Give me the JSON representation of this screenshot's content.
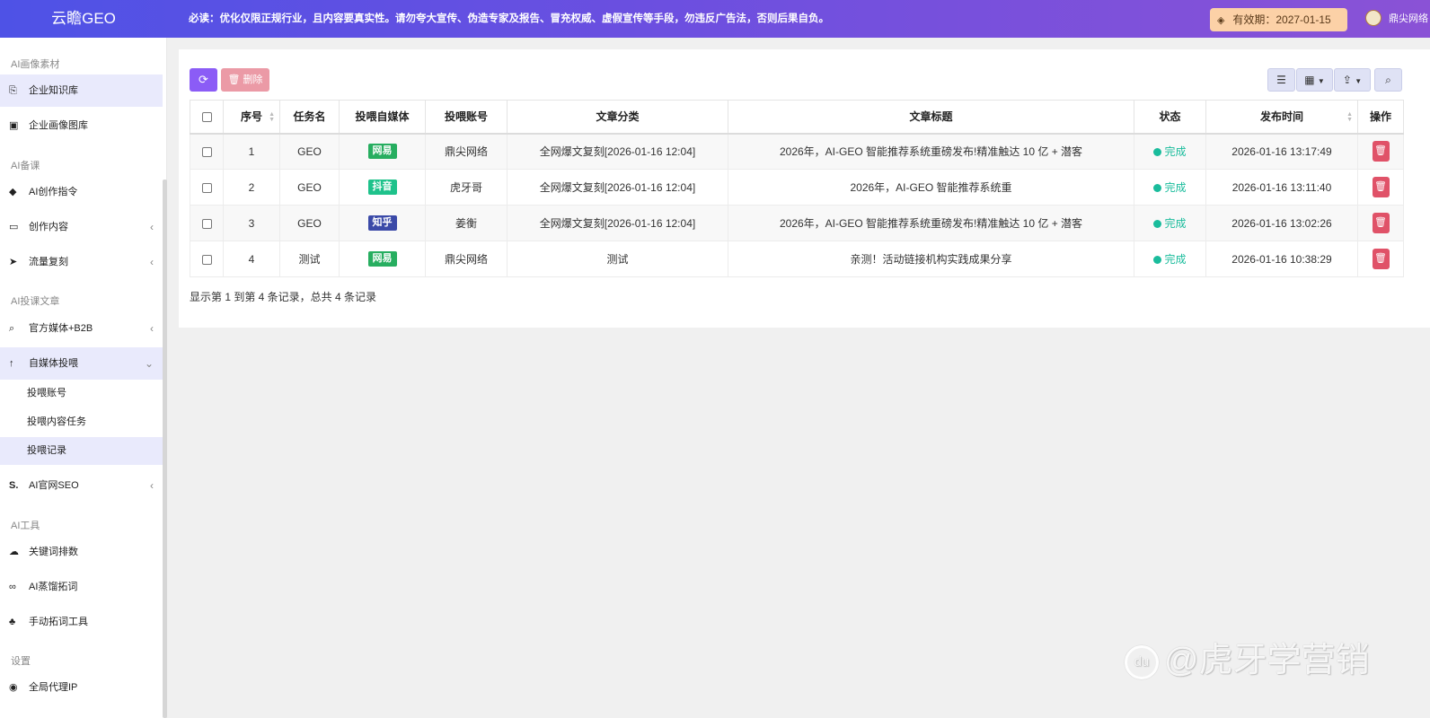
{
  "header": {
    "brand": "云瞻GEO",
    "notice": "必读：优化仅限正规行业，且内容要真实性。请勿夸大宣传、伪造专家及报告、冒充权威、虚假宣传等手段，勿违反广告法，否则后果自负。",
    "expiry": "有效期：2027-01-15",
    "user": "鼎尖网络"
  },
  "sidebar": {
    "sections": [
      {
        "label": "AI画像素材"
      },
      {
        "label": "AI备课"
      },
      {
        "label": "AI投课文章"
      },
      {
        "label": "AI工具"
      },
      {
        "label": "设置"
      }
    ],
    "items": [
      {
        "label": "企业知识库",
        "icon": "book-icon"
      },
      {
        "label": "企业画像图库",
        "icon": "image-icon"
      },
      {
        "label": "AI创作指令",
        "icon": "tag-icon"
      },
      {
        "label": "创作内容",
        "icon": "folder-icon"
      },
      {
        "label": "流量复刻",
        "icon": "rocket-icon"
      },
      {
        "label": "官方媒体+B2B",
        "icon": "search-icon"
      },
      {
        "label": "自媒体投喂",
        "icon": "arrow-up-icon"
      },
      {
        "label": "AI官网SEO",
        "icon": "seo-icon"
      },
      {
        "label": "关键词排数",
        "icon": "cloud-icon"
      },
      {
        "label": "AI蒸馏拓词",
        "icon": "link-icon"
      },
      {
        "label": "手动拓词工具",
        "icon": "sitemap-icon"
      },
      {
        "label": "全局代理IP",
        "icon": "globe-icon"
      }
    ],
    "subitems": [
      {
        "label": "投喂账号"
      },
      {
        "label": "投喂内容任务"
      },
      {
        "label": "投喂记录"
      }
    ]
  },
  "toolbar": {
    "refresh_icon": "refresh-icon",
    "delete_label": "🗑 删除"
  },
  "table": {
    "headers": [
      "序号",
      "任务名",
      "投喂自媒体",
      "投喂账号",
      "文章分类",
      "文章标题",
      "状态",
      "发布时间",
      "操作"
    ],
    "rows": [
      {
        "id": "1",
        "task": "GEO",
        "media": "网易",
        "media_color": "#27ae60",
        "account": "鼎尖网络",
        "category": "全网爆文复刻[2026-01-16 12:04]",
        "title": "2026年，AI-GEO 智能推荐系统重磅发布!精准触达 10 亿 + 潜客",
        "status": "完成",
        "time": "2026-01-16 13:17:49"
      },
      {
        "id": "2",
        "task": "GEO",
        "media": "抖音",
        "media_color": "#1ec28b",
        "account": "虎牙哥",
        "category": "全网爆文复刻[2026-01-16 12:04]",
        "title": "2026年，AI-GEO 智能推荐系统重",
        "status": "完成",
        "time": "2026-01-16 13:11:40"
      },
      {
        "id": "3",
        "task": "GEO",
        "media": "知乎",
        "media_color": "#3b4aa8",
        "account": "姜衡",
        "category": "全网爆文复刻[2026-01-16 12:04]",
        "title": "2026年，AI-GEO 智能推荐系统重磅发布!精准触达 10 亿 + 潜客",
        "status": "完成",
        "time": "2026-01-16 13:02:26"
      },
      {
        "id": "4",
        "task": "测试",
        "media": "网易",
        "media_color": "#27ae60",
        "account": "鼎尖网络",
        "category": "测试",
        "title": "亲测！活动链接机构实践成果分享",
        "status": "完成",
        "time": "2026-01-16 10:38:29"
      }
    ],
    "footer": "显示第 1 到第 4 条记录，总共 4 条记录"
  },
  "watermark": {
    "logo": "du",
    "text": "@虎牙学营销"
  },
  "colors": {
    "header_start": "#4e52e6",
    "header_end": "#8a52d6",
    "accent": "#8b5cf6",
    "status_done": "#1abc9c",
    "delete": "#e05268"
  }
}
